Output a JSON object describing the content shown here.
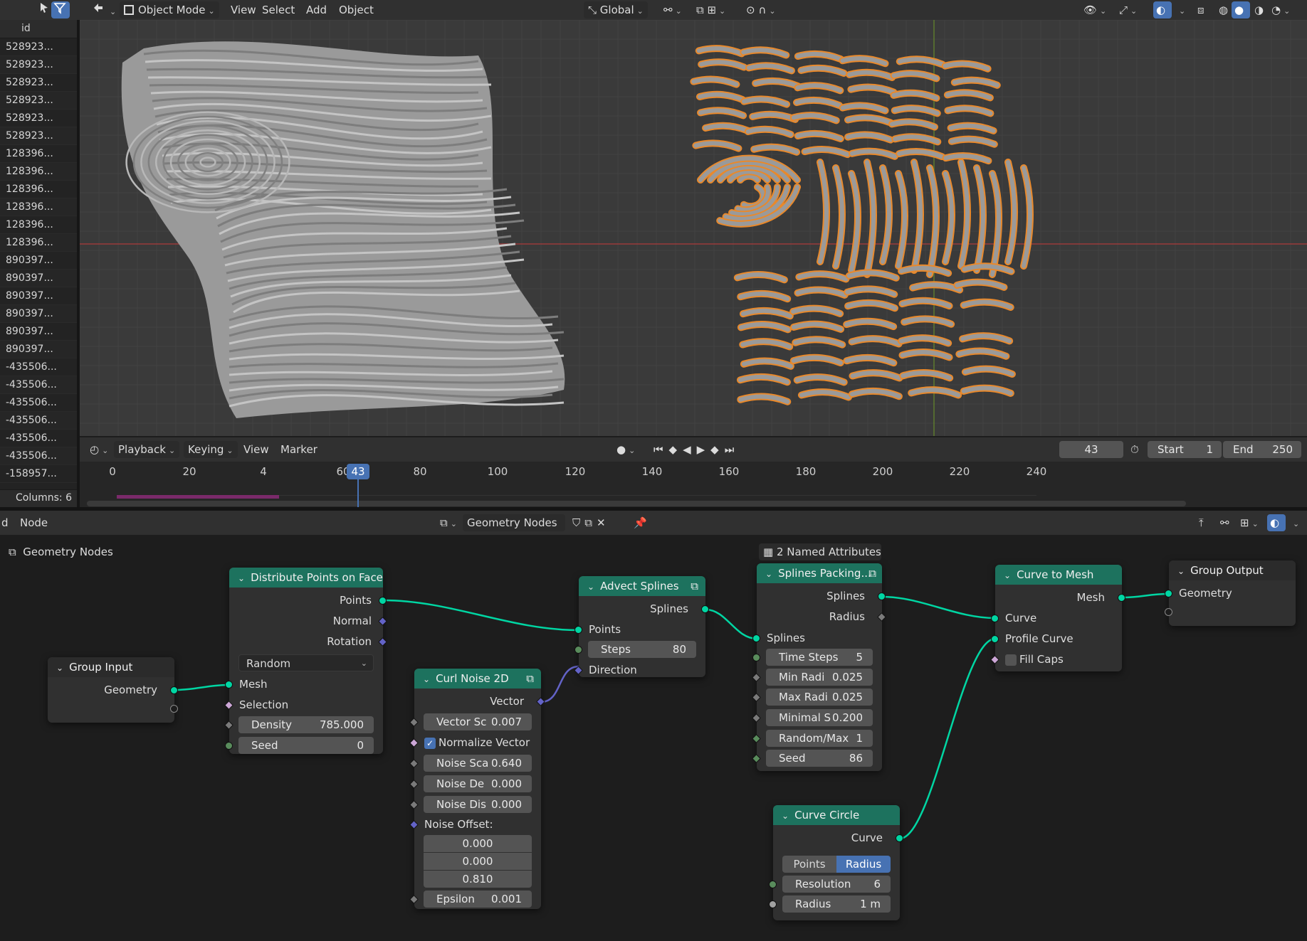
{
  "viewport_header": {
    "mode": "Object Mode",
    "menus": [
      "View",
      "Select",
      "Add",
      "Object"
    ],
    "transform_orientation": "Global"
  },
  "spreadsheet": {
    "column_header": "id",
    "rows": [
      "528923...",
      "528923...",
      "528923...",
      "528923...",
      "528923...",
      "528923...",
      "128396...",
      "128396...",
      "128396...",
      "128396...",
      "128396...",
      "128396...",
      "890397...",
      "890397...",
      "890397...",
      "890397...",
      "890397...",
      "890397...",
      "-435506...",
      "-435506...",
      "-435506...",
      "-435506...",
      "-435506...",
      "-435506...",
      "-158957..."
    ],
    "footer": "Columns: 6"
  },
  "timeline": {
    "menus": [
      "Playback",
      "Keying",
      "View",
      "Marker"
    ],
    "current_frame": "43",
    "start_label": "Start",
    "start_value": "1",
    "end_label": "End",
    "end_value": "250",
    "ticks": [
      "0",
      "20",
      "4",
      "60",
      "80",
      "100",
      "120",
      "140",
      "160",
      "180",
      "200",
      "220",
      "240"
    ]
  },
  "node_editor_header": {
    "left_fragment": "d",
    "menu": "Node",
    "tree_name": "Geometry Nodes"
  },
  "breadcrumb": "Geometry Nodes",
  "nodes": {
    "group_input": {
      "title": "Group Input",
      "geometry": "Geometry"
    },
    "distribute": {
      "title": "Distribute Points on Faces",
      "points": "Points",
      "normal": "Normal",
      "rotation": "Rotation",
      "mode": "Random",
      "mesh": "Mesh",
      "selection": "Selection",
      "density_label": "Density",
      "density_value": "785.000",
      "seed_label": "Seed",
      "seed_value": "0"
    },
    "curl_noise": {
      "title": "Curl Noise 2D",
      "vector_out": "Vector",
      "vector_sc_label": "Vector Sc",
      "vector_sc_value": "0.007",
      "normalize_label": "Normalize Vector",
      "noise_sca_label": "Noise Sca",
      "noise_sca_value": "0.640",
      "noise_de_label": "Noise De",
      "noise_de_value": "0.000",
      "noise_dis_label": "Noise Dis",
      "noise_dis_value": "0.000",
      "noise_offset_label": "Noise Offset:",
      "offset_x": "0.000",
      "offset_y": "0.000",
      "offset_z": "0.810",
      "epsilon_label": "Epsilon",
      "epsilon_value": "0.001"
    },
    "advect": {
      "title": "Advect Splines",
      "splines": "Splines",
      "points": "Points",
      "steps_label": "Steps",
      "steps_value": "80",
      "direction": "Direction"
    },
    "splines_packing": {
      "attr_label": "2 Named Attributes",
      "title": "Splines Packing...",
      "splines_out": "Splines",
      "radius_out": "Radius",
      "splines_in": "Splines",
      "time_steps_label": "Time Steps",
      "time_steps_value": "5",
      "min_radi_label": "Min Radi",
      "min_radi_value": "0.025",
      "max_radi_label": "Max Radi",
      "max_radi_value": "0.025",
      "minimal_s_label": "Minimal S",
      "minimal_s_value": "0.200",
      "random_max_label": "Random/Max",
      "random_max_value": "1",
      "seed_label": "Seed",
      "seed_value": "86"
    },
    "curve_to_mesh": {
      "title": "Curve to Mesh",
      "mesh": "Mesh",
      "curve": "Curve",
      "profile_curve": "Profile Curve",
      "fill_caps": "Fill Caps"
    },
    "group_output": {
      "title": "Group Output",
      "geometry": "Geometry"
    },
    "curve_circle": {
      "title": "Curve Circle",
      "curve": "Curve",
      "mode_points": "Points",
      "mode_radius": "Radius",
      "resolution_label": "Resolution",
      "resolution_value": "6",
      "radius_label": "Radius",
      "radius_value": "1 m"
    }
  },
  "colors": {
    "geometry_header": "#1d725e",
    "accent": "#4772b3",
    "wire": "#00d6a3",
    "outline": "#e8892c"
  }
}
